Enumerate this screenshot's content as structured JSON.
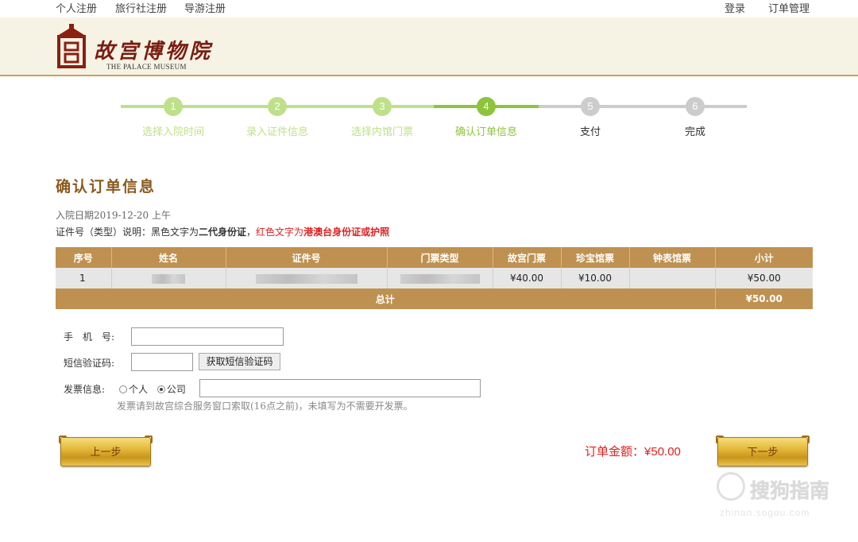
{
  "topbar": {
    "left": [
      "个人注册",
      "旅行社注册",
      "导游注册"
    ],
    "login": "登录",
    "orders": "订单管理"
  },
  "header": {
    "logo_cn": "故宫博物院",
    "logo_en": "THE PALACE MUSEUM"
  },
  "steps": [
    {
      "num": "1",
      "label": "选择入院时间",
      "state": "done"
    },
    {
      "num": "2",
      "label": "录入证件信息",
      "state": "done"
    },
    {
      "num": "3",
      "label": "选择内馆门票",
      "state": "done"
    },
    {
      "num": "4",
      "label": "确认订单信息",
      "state": "current"
    },
    {
      "num": "5",
      "label": "支付",
      "state": "todo"
    },
    {
      "num": "6",
      "label": "完成",
      "state": "todo"
    }
  ],
  "colors": {
    "done": "#bfe08a",
    "current": "#8dc43c",
    "todo": "#cccccc",
    "accent": "#bf9150",
    "red": "#e02020"
  },
  "page_title": "确认订单信息",
  "visit_date": "入院日期2019-12-20 上午",
  "id_note": {
    "prefix": "证件号（类型）说明：黑色文字为",
    "black_bold": "二代身份证",
    "comma": "，",
    "red_prefix": "红色文字为",
    "red_bold": "港澳台身份证或护照"
  },
  "table": {
    "headers": [
      "序号",
      "姓名",
      "证件号",
      "门票类型",
      "故宫门票",
      "珍宝馆票",
      "钟表馆票",
      "小计"
    ],
    "rows": [
      {
        "no": "1",
        "name": "",
        "id": "",
        "type": "",
        "palace": "¥40.00",
        "treasure": "¥10.00",
        "clock": "",
        "subtotal": "¥50.00"
      }
    ],
    "total_label": "总计",
    "total_value": "¥50.00"
  },
  "form": {
    "phone_label": "手　机　号:",
    "sms_label": "短信验证码:",
    "sms_button": "获取短信验证码",
    "invoice_label": "发票信息:",
    "opt_personal": "个人",
    "opt_company": "公司",
    "selected": "公司",
    "invoice_note": "发票请到故宫综合服务窗口索取(16点之前)，未填写为不需要开发票。"
  },
  "buttons": {
    "prev": "上一步",
    "next": "下一步"
  },
  "order_amount": {
    "label": "订单金额：",
    "value": "¥50.00"
  },
  "watermark": {
    "text": "搜狗指南",
    "sub": "zhinan.sogou.com"
  }
}
